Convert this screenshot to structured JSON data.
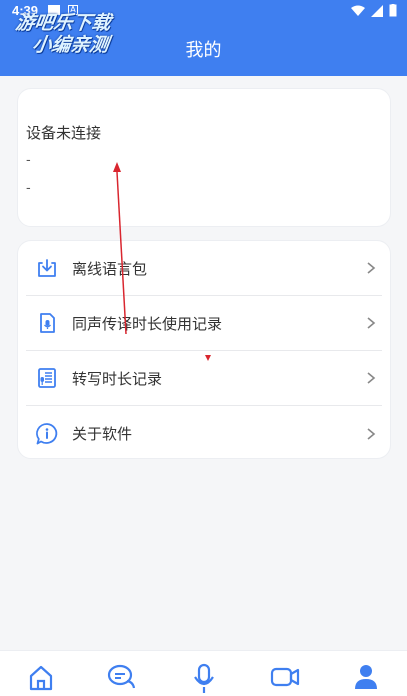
{
  "status_bar": {
    "time": "4:39"
  },
  "watermark": {
    "line1": "游吧乐下载",
    "line2": "小编亲测"
  },
  "header": {
    "title": "我的"
  },
  "device": {
    "status": "设备未连接",
    "line1": "-",
    "line2": "-"
  },
  "menu": {
    "items": [
      {
        "label": "离线语言包",
        "icon": "download-icon"
      },
      {
        "label": "同声传译时长使用记录",
        "icon": "document-mic-icon"
      },
      {
        "label": "转写时长记录",
        "icon": "transcript-icon"
      },
      {
        "label": "关于软件",
        "icon": "info-chat-icon"
      }
    ]
  },
  "bottom_nav": {
    "items": [
      {
        "icon": "home-icon"
      },
      {
        "icon": "chat-icon"
      },
      {
        "icon": "microphone-icon"
      },
      {
        "icon": "video-icon"
      },
      {
        "icon": "user-icon",
        "active": true
      }
    ]
  },
  "colors": {
    "primary": "#3f7ff0",
    "background": "#f5f6f8",
    "annotation": "#d9262f"
  }
}
